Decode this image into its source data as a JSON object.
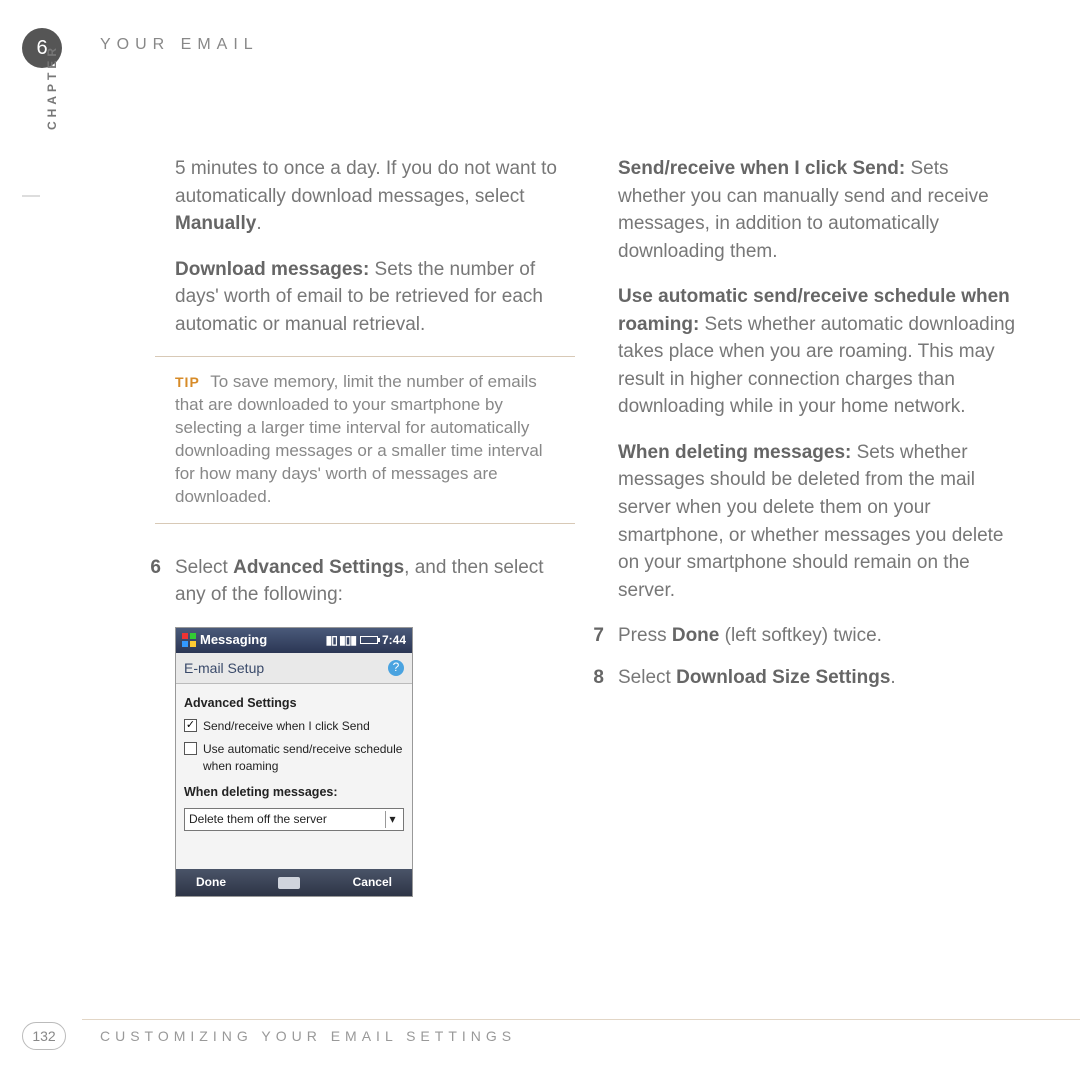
{
  "chapter_number": "6",
  "header_title": "YOUR EMAIL",
  "chapter_vert": "CHAPTER",
  "page_number": "132",
  "footer_title": "CUSTOMIZING YOUR EMAIL SETTINGS",
  "left": {
    "p1_a": "5 minutes to once a day. If you do not want to automatically download messages, select ",
    "p1_b": "Manually",
    "p1_c": ".",
    "p2_b": "Download messages:",
    "p2_r": " Sets the number of days' worth of email to be retrieved for each automatic or manual retrieval.",
    "tip_label": "TIP",
    "tip_text": " To save memory, limit the number of emails that are downloaded to your smartphone by selecting a larger time interval for automatically downloading messages or a smaller time interval for how many days' worth of messages are downloaded.",
    "step6_num": "6",
    "step6_a": "Select ",
    "step6_b": "Advanced Settings",
    "step6_c": ", and then select any of the following:"
  },
  "shot": {
    "title": "Messaging",
    "time": "7:44",
    "subtitle": "E-mail Setup",
    "heading": "Advanced Settings",
    "cb1": "Send/receive when I click Send",
    "cb2": "Use automatic send/receive schedule when roaming",
    "when_label": "When deleting messages:",
    "dd_value": "Delete them off the server",
    "soft_left": "Done",
    "soft_right": "Cancel"
  },
  "right": {
    "p1_b": "Send/receive when I click Send:",
    "p1_r": " Sets whether you can manually send and receive messages, in addition to automatically downloading them.",
    "p2_b": "Use automatic send/receive schedule when roaming:",
    "p2_r": " Sets whether automatic downloading takes place when you are roaming. This may result in higher connection charges than downloading while in your home network.",
    "p3_b": "When deleting messages:",
    "p3_r": " Sets whether messages should be deleted from the mail server when you delete them on your smartphone, or whether messages you delete on your smartphone should remain on the server.",
    "step7_num": "7",
    "step7_a": "Press ",
    "step7_b": "Done",
    "step7_c": " (left softkey) twice.",
    "step8_num": "8",
    "step8_a": "Select ",
    "step8_b": "Download Size Settings",
    "step8_c": "."
  }
}
